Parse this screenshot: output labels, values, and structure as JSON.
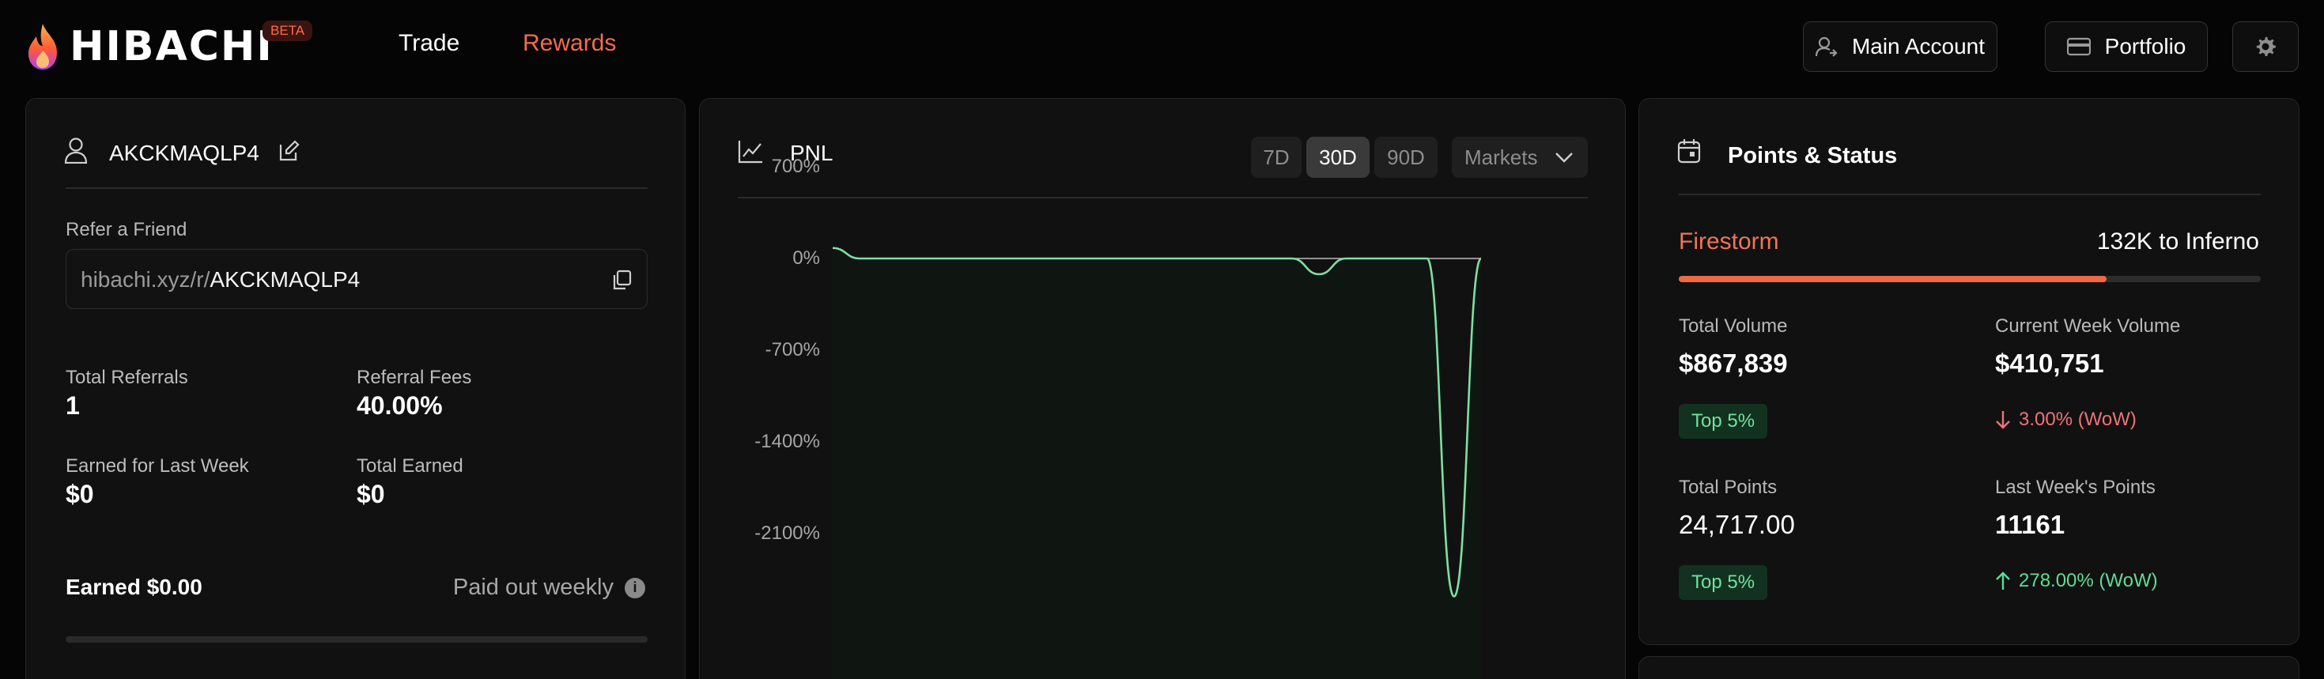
{
  "header": {
    "brand": "HIBACHI",
    "beta_badge": "BETA",
    "nav": {
      "trade": "Trade",
      "rewards": "Rewards"
    },
    "main_account": "Main Account",
    "portfolio": "Portfolio"
  },
  "referral": {
    "username": "AKCKMAQLP4",
    "refer_label": "Refer a Friend",
    "link_prefix": "hibachi.xyz/r/",
    "link_code": "AKCKMAQLP4",
    "total_referrals_label": "Total Referrals",
    "total_referrals": "1",
    "referral_fees_label": "Referral Fees",
    "referral_fees": "40.00%",
    "earned_last_week_label": "Earned for Last Week",
    "earned_last_week": "$0",
    "total_earned_label": "Total Earned",
    "total_earned": "$0",
    "earned_summary": "Earned $0.00",
    "paid_out": "Paid out weekly"
  },
  "pnl": {
    "title": "PNL",
    "ranges": [
      "7D",
      "30D",
      "90D"
    ],
    "selected_range": "30D",
    "markets_label": "Markets",
    "line_color": "#7ee0a3"
  },
  "chart_data": {
    "type": "line",
    "yticks": [
      "700%",
      "0%",
      "-700%",
      "-1400%",
      "-2100%"
    ],
    "ylim": [
      -2600,
      900
    ],
    "series": [
      {
        "values": [
          80,
          0,
          0,
          0,
          0,
          0,
          0,
          0,
          0,
          0,
          0,
          0,
          0,
          0,
          0,
          0,
          0,
          0,
          -120,
          0,
          0,
          0,
          0,
          -2580,
          0
        ]
      }
    ]
  },
  "points": {
    "title": "Points & Status",
    "current_tier": "Firestorm",
    "next_tier_text": "132K to Inferno",
    "tier_progress": 0.735,
    "total_volume_label": "Total Volume",
    "total_volume": "$867,839",
    "total_volume_badge": "Top 5%",
    "current_week_volume_label": "Current Week Volume",
    "current_week_volume": "$410,751",
    "current_week_change": "3.00% (WoW)",
    "total_points_label": "Total Points",
    "total_points": "24,717.00",
    "total_points_badge": "Top 5%",
    "last_week_points_label": "Last Week's Points",
    "last_week_points": "11161",
    "last_week_change": "278.00% (WoW)"
  }
}
